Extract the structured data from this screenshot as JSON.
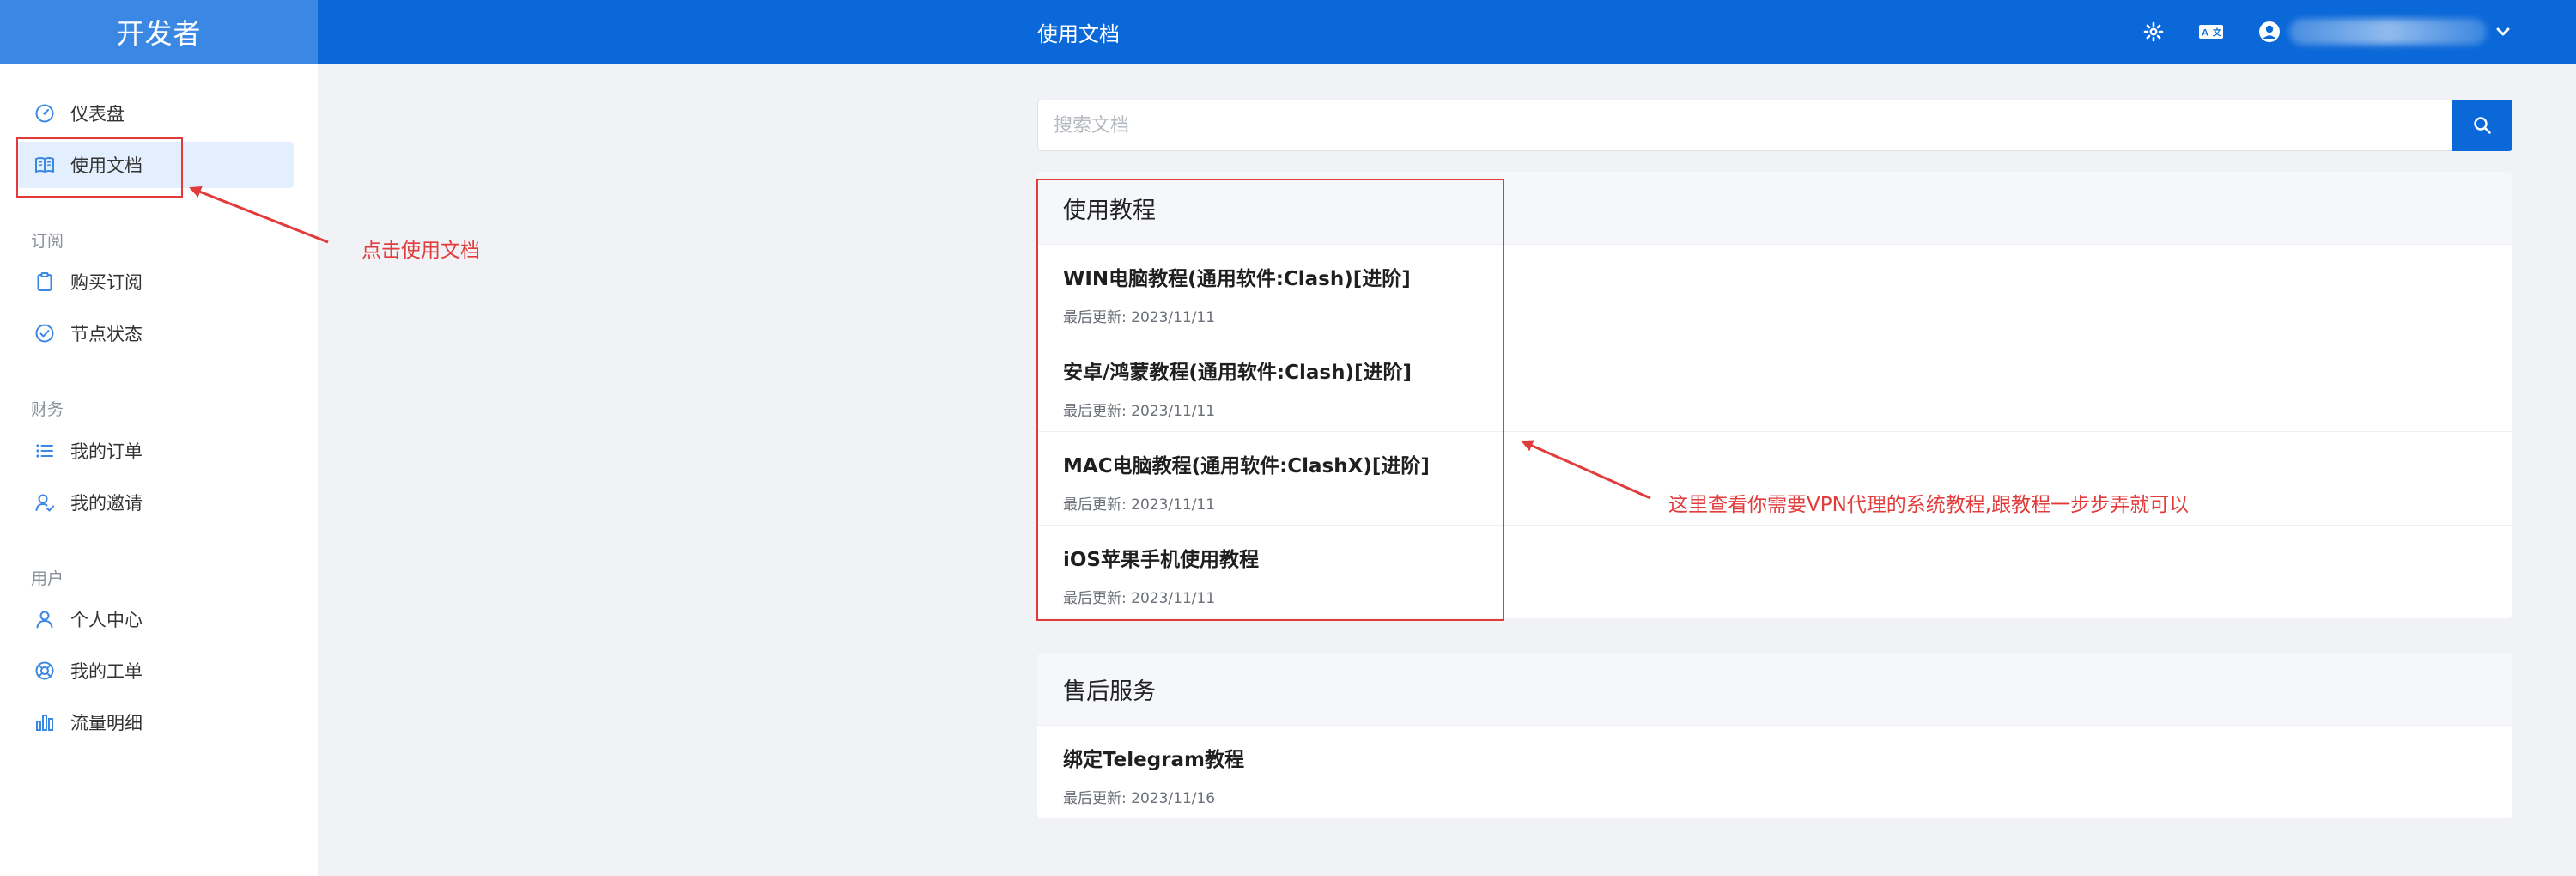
{
  "brand": {
    "name": "开发者"
  },
  "header": {
    "title": "使用文档",
    "theme_icon": "gear-icon",
    "translate_icon": "translate-icon",
    "user_icon": "user-circle-icon",
    "dropdown_icon": "chevron-down-icon"
  },
  "sidebar": {
    "items_top": [
      {
        "label": "仪表盘",
        "icon": "dashboard-gauge-icon"
      },
      {
        "label": "使用文档",
        "icon": "book-icon",
        "active": true
      }
    ],
    "group_subscribe": {
      "title": "订阅",
      "items": [
        {
          "label": "购买订阅",
          "icon": "clipboard-icon"
        },
        {
          "label": "节点状态",
          "icon": "check-circle-icon"
        }
      ]
    },
    "group_finance": {
      "title": "财务",
      "items": [
        {
          "label": "我的订单",
          "icon": "list-icon"
        },
        {
          "label": "我的邀请",
          "icon": "user-invite-icon"
        }
      ]
    },
    "group_user": {
      "title": "用户",
      "items": [
        {
          "label": "个人中心",
          "icon": "user-icon"
        },
        {
          "label": "我的工单",
          "icon": "lifebuoy-icon"
        },
        {
          "label": "流量明细",
          "icon": "bar-chart-icon"
        }
      ]
    }
  },
  "search": {
    "placeholder": "搜索文档",
    "value": ""
  },
  "tutorials": {
    "title": "使用教程",
    "items": [
      {
        "title": "WIN电脑教程(通用软件:Clash)[进阶]",
        "updated": "最后更新: 2023/11/11"
      },
      {
        "title": "安卓/鸿蒙教程(通用软件:Clash)[进阶]",
        "updated": "最后更新: 2023/11/11"
      },
      {
        "title": "MAC电脑教程(通用软件:ClashX)[进阶]",
        "updated": "最后更新: 2023/11/11"
      },
      {
        "title": "iOS苹果手机使用教程",
        "updated": "最后更新: 2023/11/11"
      }
    ]
  },
  "after_sales": {
    "title": "售后服务",
    "items": [
      {
        "title": "绑定Telegram教程",
        "updated": "最后更新: 2023/11/16"
      }
    ]
  },
  "annotations": {
    "click_docs": "点击使用文档",
    "view_tutorials": "这里查看你需要VPN代理的系统教程,跟教程一步步弄就可以",
    "color": "#e23b3b"
  },
  "colors": {
    "brand_bg": "#3a88e4",
    "header_bg": "#0b68d8",
    "active_bg": "#e3efff"
  }
}
